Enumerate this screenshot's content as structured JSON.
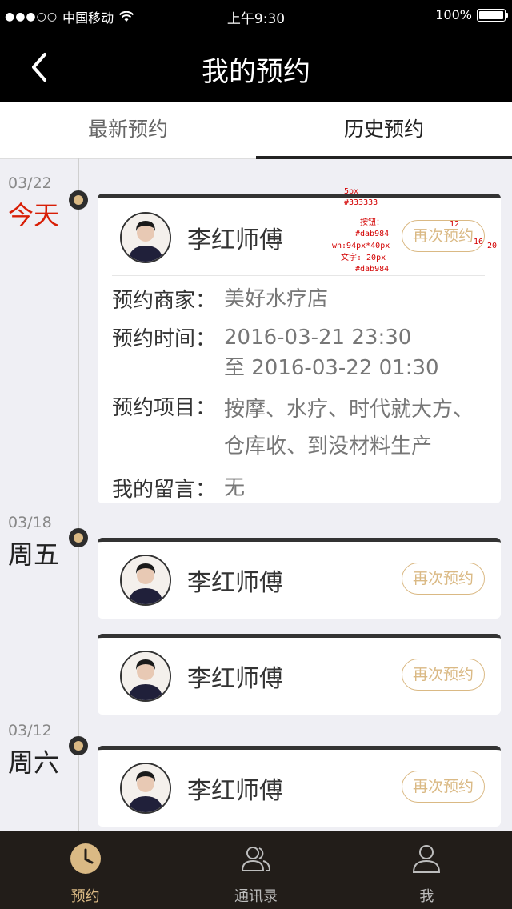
{
  "status_bar": {
    "carrier": "中国移动",
    "time": "上午9:30",
    "battery": "100%"
  },
  "nav": {
    "title": "我的预约"
  },
  "tabs": [
    {
      "label": "最新预约"
    },
    {
      "label": "历史预约"
    }
  ],
  "groups": [
    {
      "date": "03/22",
      "day": "今天",
      "cards": [
        {
          "name": "李红师傅",
          "button": "再次预约",
          "details": {
            "merchant_label": "预约商家：",
            "merchant": "美好水疗店",
            "time_label": "预约时间：",
            "time_start": "2016-03-21 23:30",
            "time_end": "至 2016-03-22 01:30",
            "items_label": "预约项目：",
            "items": "按摩、水疗、时代就大方、仓库收、到没材料生产",
            "message_label": "我的留言：",
            "message": "无"
          }
        }
      ]
    },
    {
      "date": "03/18",
      "day": "周五",
      "cards": [
        {
          "name": "李红师傅",
          "button": "再次预约"
        },
        {
          "name": "李红师傅",
          "button": "再次预约"
        }
      ]
    },
    {
      "date": "03/12",
      "day": "周六",
      "cards": [
        {
          "name": "李红师傅",
          "button": "再次预约"
        }
      ]
    }
  ],
  "annotations": {
    "border_w": "5px",
    "border_c": "#333333",
    "btn_label": "按钮：",
    "btn_color": "#dab984",
    "btn_wh": "wh:94px*40px",
    "text_size": "文字: 20px",
    "text_color": "#dab984",
    "n12": "12",
    "n16": "16",
    "n20": "20"
  },
  "tabbar": [
    {
      "label": "预约",
      "icon": "clock-icon"
    },
    {
      "label": "通讯录",
      "icon": "contacts-icon"
    },
    {
      "label": "我",
      "icon": "user-icon"
    }
  ],
  "colors": {
    "accent": "#dab984",
    "today": "#d81e06",
    "dark": "#333333"
  }
}
